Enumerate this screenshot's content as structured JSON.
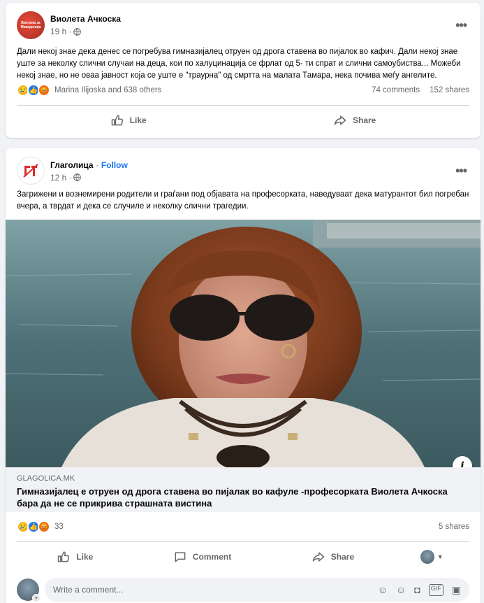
{
  "post1": {
    "author": "Виолета Ачкоска",
    "time": "19 h",
    "avatar_text": "Вистина за Македонија",
    "text": "Дали некој знае дека денес се погребува гимназијалец  отруен од дрога ставена во пијалок во кафич. Дали некој знае уште за неколку слични случаи на деца, кои по халуцинација се фрлат од 5- ти спрат и слични самоубиства... Можеби некој знае, но не оваа јавност која се уште е \"траурна\" од смртта на малата Тамара, нека почива меѓу ангелите.",
    "reactions_text": "Marina Ilijoska and 638 others",
    "comments": "74 comments",
    "shares": "152 shares",
    "like_label": "Like",
    "share_label": "Share"
  },
  "post2": {
    "author": "Глаголица",
    "separator": "·",
    "follow": "Follow",
    "time": "12 h",
    "text": "Загрижени и вознемирени родители и граѓани под објавата на професорката, наведуваат дека матурантот бил погребан вчера, а тврдат и дека се случиле и неколку слични трагедии.",
    "link_domain": "GLAGOLICA.MK",
    "link_title": "Гимназијалец е отруен од дрога ставена во пијалак во кафуле -професорката Виолета Ачкоска бара да не се прикрива страшната вистина",
    "reactions_count": "33",
    "shares": "5 shares",
    "like_label": "Like",
    "comment_label": "Comment",
    "share_label": "Share",
    "comment_placeholder": "Write a comment..."
  },
  "colors": {
    "accent": "#1877f2",
    "sad": "#f7b125",
    "angry": "#e9710f"
  }
}
